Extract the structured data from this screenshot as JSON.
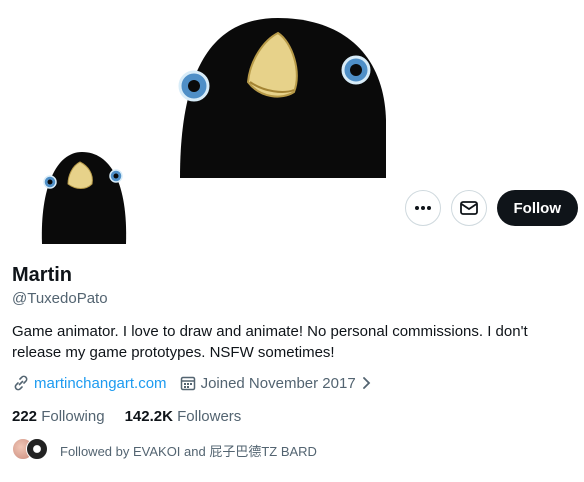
{
  "profile": {
    "display_name": "Martin",
    "handle": "@TuxedoPato",
    "bio": "Game animator. I love to draw and animate! No personal commissions. I don't release my game prototypes. NSFW sometimes!",
    "website": "martinchangart.com",
    "joined": "Joined November 2017"
  },
  "stats": {
    "following_count": "222",
    "following_label": "Following",
    "followers_count": "142.2K",
    "followers_label": "Followers"
  },
  "followed_by": "Followed by EVAKOI and 屁子巴德TZ BARD",
  "actions": {
    "follow_label": "Follow",
    "more_icon": "more-icon",
    "message_icon": "envelope-icon"
  },
  "colors": {
    "accent": "#1d9bf0",
    "follow_button": "#0f1419",
    "secondary_text": "#536471"
  }
}
